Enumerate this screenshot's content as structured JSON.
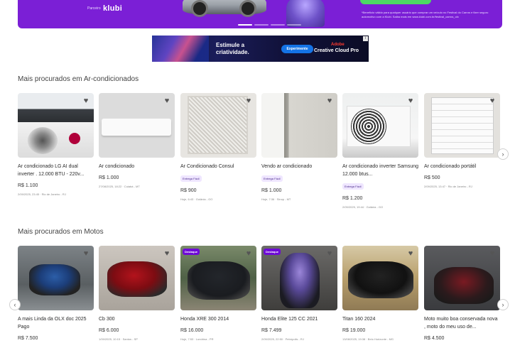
{
  "promo": {
    "sponsor_prefix": "Parceiro",
    "logo": "klubi",
    "fine_print": "*Benefício válido para qualquer usuário que comprar um veículo no Festival do Carros e fizer seguro automotivo com a Klubi. Saiba mais em www.klubi.com.br/festival_carros_olx"
  },
  "ad": {
    "line1": "Estimule a",
    "line2": "criatividade.",
    "button": "Experimente",
    "brand": "Adobe",
    "product": "Creative Cloud Pro",
    "adchoice": "i"
  },
  "sections": [
    {
      "title": "Mais procurados em Ar-condicionados",
      "items": [
        {
          "title": "Ar condicionado LG AI dual inverter . 12.000 BTU - 220v...",
          "price": "R$ 1.100",
          "meta": "2/09/2025, 23:45 · Rio de Janeiro - RJ",
          "tag": ""
        },
        {
          "title": "Ar condicionado",
          "price": "R$ 1.000",
          "meta": "27/08/2025, 18:22 · Cuiabá - MT",
          "tag": ""
        },
        {
          "title": "Ar Condicionado Consul",
          "price": "R$ 900",
          "meta": "Hoje, 6:43 · Goiânia - GO",
          "tag": "Entrega Fácil"
        },
        {
          "title": "Vendo ar condicionado",
          "price": "R$ 1.000",
          "meta": "Hoje, 7:36 · Sinop - MT",
          "tag": "Entrega Fácil"
        },
        {
          "title": "Ar condicionado inverter Samsung 12.000 btus...",
          "price": "R$ 1.200",
          "meta": "2/09/2025, 19:44 · Goiânia - GO",
          "tag": "Entrega Fácil"
        },
        {
          "title": "Ar condicionado portátil",
          "price": "R$ 500",
          "meta": "2/09/2025, 13:47 · Rio de Janeiro - RJ",
          "tag": ""
        }
      ]
    },
    {
      "title": "Mais procurados em Motos",
      "items": [
        {
          "title": "A mais Linda da OLX doc 2025 Pago",
          "price": "R$ 7.500",
          "meta": "",
          "badge": ""
        },
        {
          "title": "Cb 300",
          "price": "R$ 6.000",
          "meta": "1/09/2025, 10:15 · Santos - SP",
          "badge": ""
        },
        {
          "title": "Honda XRE 300 2014",
          "price": "R$ 16.000",
          "meta": "Hoje, 7:53 · Londrina - PR",
          "badge": "Destaque"
        },
        {
          "title": "Honda Elite 125 CC 2021",
          "price": "R$ 7.499",
          "meta": "2/09/2025, 22:50 · Petrópolis - RJ",
          "badge": "Destaque"
        },
        {
          "title": "Titan 160 2024",
          "price": "R$ 19.000",
          "meta": "13/08/2025, 19:38 · Belo Horizonte - MG",
          "badge": ""
        },
        {
          "title": "Moto muito boa conservada nova , moto do meu uso de...",
          "price": "R$ 4.500",
          "meta": "",
          "badge": ""
        }
      ]
    }
  ],
  "icons": {
    "heart": "♥",
    "next": "›",
    "prev": "‹"
  }
}
